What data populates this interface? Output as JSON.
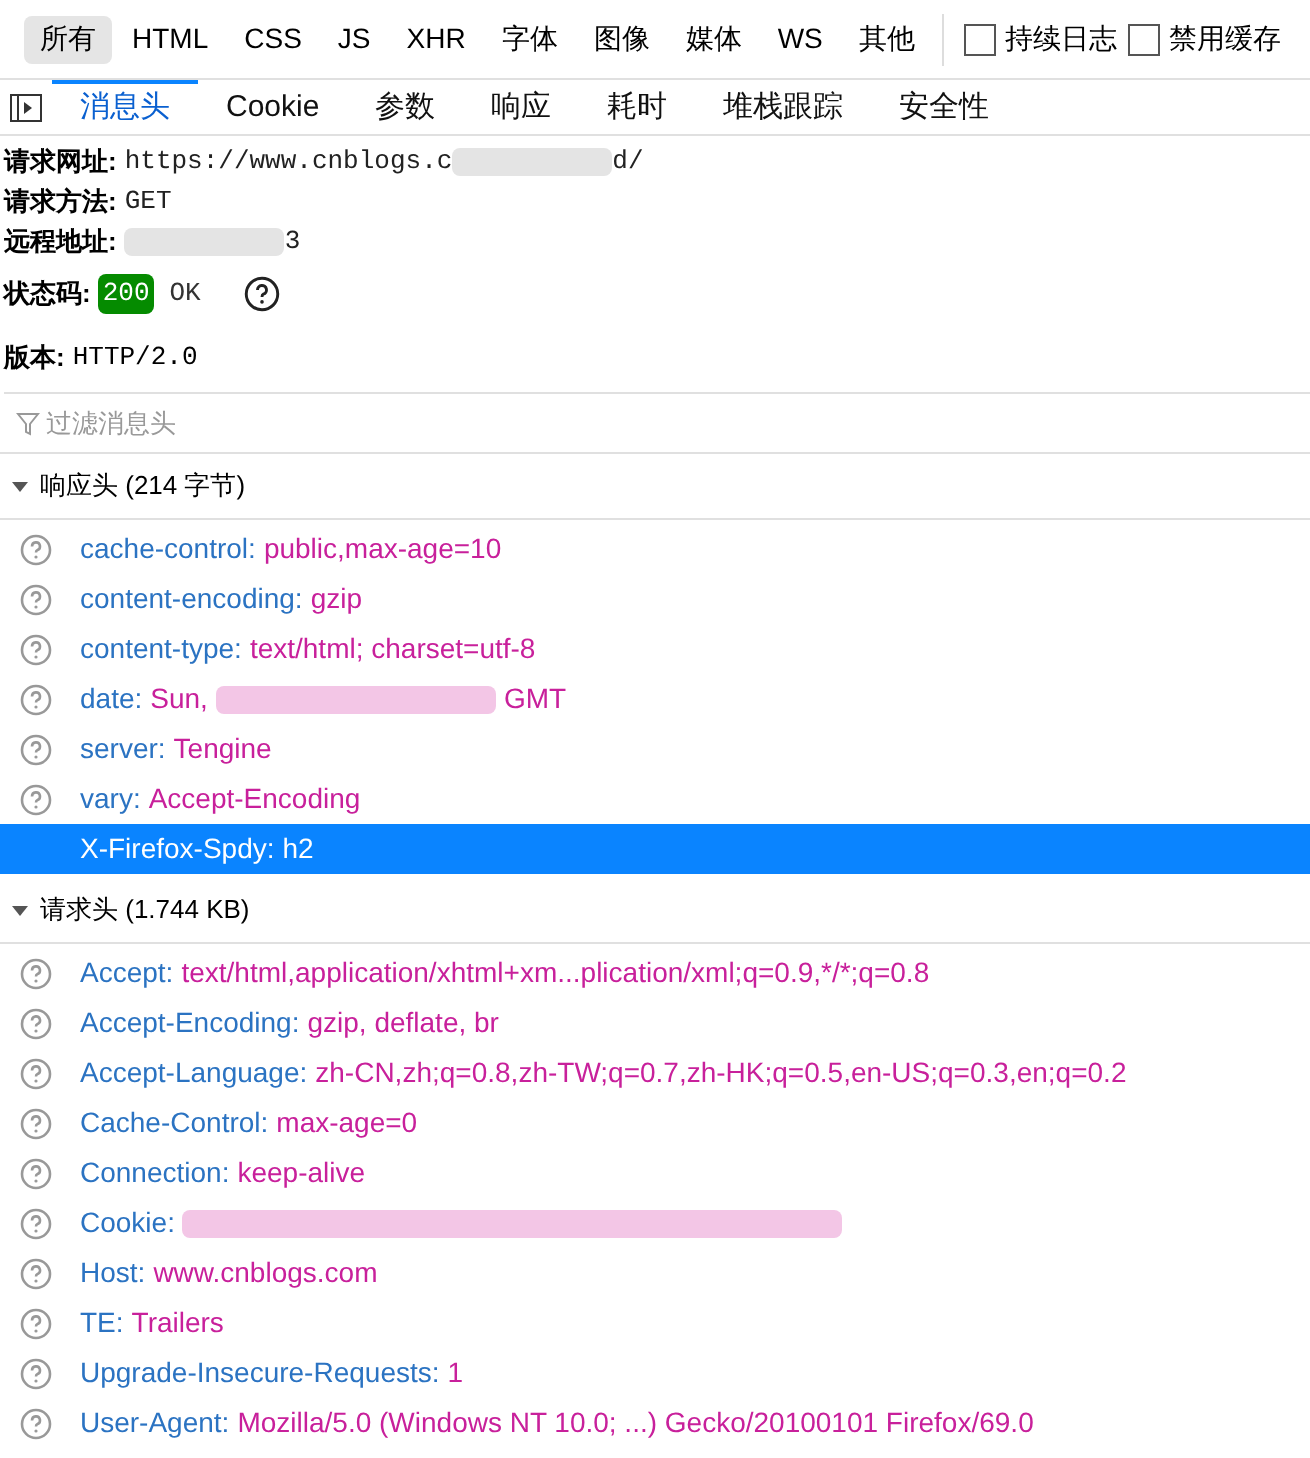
{
  "type_filters": [
    {
      "label": "所有",
      "selected": true
    },
    {
      "label": "HTML",
      "selected": false
    },
    {
      "label": "CSS",
      "selected": false
    },
    {
      "label": "JS",
      "selected": false
    },
    {
      "label": "XHR",
      "selected": false
    },
    {
      "label": "字体",
      "selected": false
    },
    {
      "label": "图像",
      "selected": false
    },
    {
      "label": "媒体",
      "selected": false
    },
    {
      "label": "WS",
      "selected": false
    },
    {
      "label": "其他",
      "selected": false
    }
  ],
  "options": [
    {
      "label": "持续日志",
      "checked": false
    },
    {
      "label": "禁用缓存",
      "checked": false
    }
  ],
  "tabs": [
    {
      "label": "消息头",
      "selected": true
    },
    {
      "label": "Cookie",
      "selected": false
    },
    {
      "label": "参数",
      "selected": false
    },
    {
      "label": "响应",
      "selected": false
    },
    {
      "label": "耗时",
      "selected": false
    },
    {
      "label": "堆栈跟踪",
      "selected": false
    },
    {
      "label": "安全性",
      "selected": false
    }
  ],
  "summary": [
    {
      "label": "请求网址:",
      "parts": [
        {
          "kind": "text",
          "text": "https://www.cnblogs.c"
        },
        {
          "kind": "redacted"
        },
        {
          "kind": "text",
          "text": "d/"
        }
      ]
    },
    {
      "label": "请求方法:",
      "parts": [
        {
          "kind": "text",
          "text": "GET"
        }
      ]
    },
    {
      "label": "远程地址:",
      "parts": [
        {
          "kind": "redacted"
        },
        {
          "kind": "text",
          "text": "3"
        }
      ]
    }
  ],
  "status": {
    "label": "状态码:",
    "code": "200",
    "text": "OK"
  },
  "version": {
    "label": "版本:",
    "value": "HTTP/2.0"
  },
  "filter": {
    "placeholder": "过滤消息头"
  },
  "sections": [
    {
      "title": "响应头 (214 字节)",
      "expanded": true,
      "headers": [
        {
          "name": "cache-control:",
          "selected": false,
          "parts": [
            {
              "kind": "text",
              "text": "public,max-age=10"
            }
          ]
        },
        {
          "name": "content-encoding:",
          "selected": false,
          "parts": [
            {
              "kind": "text",
              "text": "gzip"
            }
          ]
        },
        {
          "name": "content-type:",
          "selected": false,
          "parts": [
            {
              "kind": "text",
              "text": "text/html; charset=utf-8"
            }
          ]
        },
        {
          "name": "date:",
          "selected": false,
          "parts": [
            {
              "kind": "text",
              "text": "Sun,"
            },
            {
              "kind": "redacted"
            },
            {
              "kind": "text",
              "text": "GMT"
            }
          ]
        },
        {
          "name": "server:",
          "selected": false,
          "parts": [
            {
              "kind": "text",
              "text": "Tengine"
            }
          ]
        },
        {
          "name": "vary:",
          "selected": false,
          "parts": [
            {
              "kind": "text",
              "text": "Accept-Encoding"
            }
          ]
        },
        {
          "name": "X-Firefox-Spdy:",
          "selected": true,
          "parts": [
            {
              "kind": "text",
              "text": "h2"
            }
          ]
        }
      ]
    },
    {
      "title": "请求头 (1.744 KB)",
      "expanded": true,
      "headers": [
        {
          "name": "Accept:",
          "selected": false,
          "parts": [
            {
              "kind": "text",
              "text": "text/html,application/xhtml+xm...plication/xml;q=0.9,*/*;q=0.8"
            }
          ]
        },
        {
          "name": "Accept-Encoding:",
          "selected": false,
          "parts": [
            {
              "kind": "text",
              "text": "gzip, deflate, br"
            }
          ]
        },
        {
          "name": "Accept-Language:",
          "selected": false,
          "parts": [
            {
              "kind": "text",
              "text": "zh-CN,zh;q=0.8,zh-TW;q=0.7,zh-HK;q=0.5,en-US;q=0.3,en;q=0.2"
            }
          ]
        },
        {
          "name": "Cache-Control:",
          "selected": false,
          "parts": [
            {
              "kind": "text",
              "text": "max-age=0"
            }
          ]
        },
        {
          "name": "Connection:",
          "selected": false,
          "parts": [
            {
              "kind": "text",
              "text": "keep-alive"
            }
          ]
        },
        {
          "name": "Cookie:",
          "selected": false,
          "parts": [
            {
              "kind": "redacted"
            }
          ]
        },
        {
          "name": "Host:",
          "selected": false,
          "parts": [
            {
              "kind": "text",
              "text": "www.cnblogs.com"
            }
          ]
        },
        {
          "name": "TE:",
          "selected": false,
          "parts": [
            {
              "kind": "text",
              "text": "Trailers"
            }
          ]
        },
        {
          "name": "Upgrade-Insecure-Requests:",
          "selected": false,
          "parts": [
            {
              "kind": "text",
              "text": "1"
            }
          ]
        },
        {
          "name": "User-Agent:",
          "selected": false,
          "parts": [
            {
              "kind": "text",
              "text": "Mozilla/5.0 (Windows NT 10.0; ...) Gecko/20100101 Firefox/69.0"
            }
          ]
        }
      ]
    }
  ]
}
